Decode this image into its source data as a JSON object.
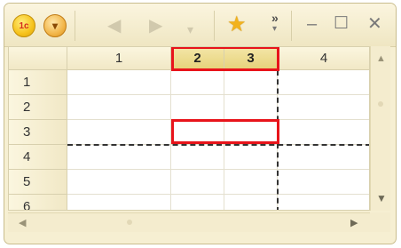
{
  "toolbar": {
    "logo_text": "1с",
    "menu_glyph": "▾",
    "back_glyph": "◀",
    "forward_glyph": "▶",
    "history_glyph": "▾",
    "favorite_glyph": "★",
    "more_glyph": "»",
    "more_drop_glyph": "▾"
  },
  "window_controls": {
    "minimize": "–",
    "maximize": "☐",
    "close": "✕"
  },
  "spreadsheet": {
    "columns": [
      "1",
      "2",
      "3",
      "4"
    ],
    "rows": [
      "1",
      "2",
      "3",
      "4",
      "5",
      "6"
    ]
  },
  "scrollbars": {
    "up": "▲",
    "down": "▼",
    "left": "◀",
    "right": "▶"
  },
  "colors": {
    "highlight_border": "#e8141b",
    "window_background": "#f6efd2"
  }
}
